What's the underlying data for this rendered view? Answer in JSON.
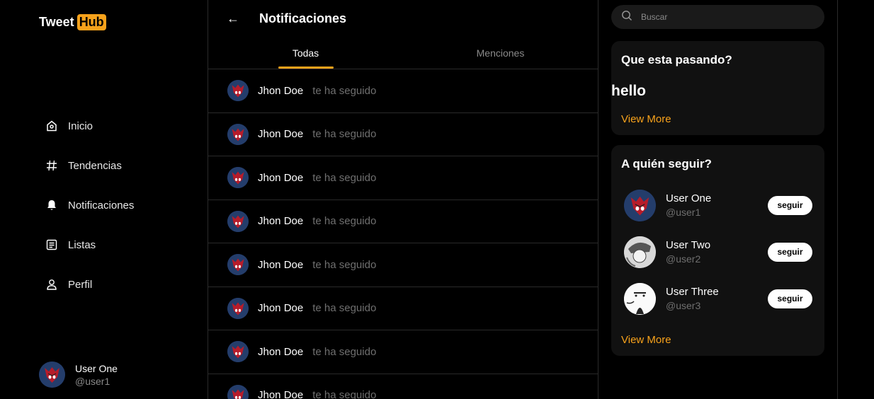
{
  "brand": {
    "part1": "Tweet",
    "part2": "Hub",
    "accent": "#f7a21b"
  },
  "nav": [
    {
      "label": "Inicio",
      "icon": "home-icon"
    },
    {
      "label": "Tendencias",
      "icon": "hashtag-icon"
    },
    {
      "label": "Notificaciones",
      "icon": "bell-icon"
    },
    {
      "label": "Listas",
      "icon": "list-icon"
    },
    {
      "label": "Perfil",
      "icon": "user-icon"
    }
  ],
  "current_user": {
    "name": "User One",
    "handle": "@user1"
  },
  "main": {
    "back_icon": "arrow-left-icon",
    "title": "Notificaciones",
    "tabs": [
      {
        "label": "Todas",
        "active": true
      },
      {
        "label": "Menciones",
        "active": false
      }
    ],
    "notifications": [
      {
        "user": "Jhon Doe",
        "action": "te ha seguido"
      },
      {
        "user": "Jhon Doe",
        "action": "te ha seguido"
      },
      {
        "user": "Jhon Doe",
        "action": "te ha seguido"
      },
      {
        "user": "Jhon Doe",
        "action": "te ha seguido"
      },
      {
        "user": "Jhon Doe",
        "action": "te ha seguido"
      },
      {
        "user": "Jhon Doe",
        "action": "te ha seguido"
      },
      {
        "user": "Jhon Doe",
        "action": "te ha seguido"
      },
      {
        "user": "Jhon Doe",
        "action": "te ha seguido"
      }
    ]
  },
  "right": {
    "search": {
      "placeholder": "Buscar",
      "icon": "search-icon"
    },
    "trends": {
      "title": "Que esta pasando?",
      "item": "hello",
      "view_more": "View More"
    },
    "who_to_follow": {
      "title": "A quién seguir?",
      "users": [
        {
          "name": "User One",
          "handle": "@user1",
          "button": "seguir"
        },
        {
          "name": "User Two",
          "handle": "@user2",
          "button": "seguir"
        },
        {
          "name": "User Three",
          "handle": "@user3",
          "button": "seguir"
        }
      ],
      "view_more": "View More"
    }
  }
}
